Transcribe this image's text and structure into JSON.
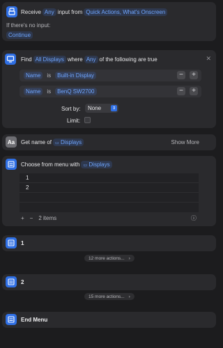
{
  "receive": {
    "label": "Receive",
    "any": "Any",
    "input_from": "input from",
    "sources": "Quick Actions, What's Onscreen",
    "no_input_label": "If there's no input:",
    "continue": "Continue"
  },
  "find": {
    "label": "Find",
    "target": "All Displays",
    "where": "where",
    "any": "Any",
    "suffix": "of the following are true",
    "conditions": [
      {
        "field": "Name",
        "op": "is",
        "value": "Built-in Display"
      },
      {
        "field": "Name",
        "op": "is",
        "value": "BenQ SW2700"
      }
    ],
    "sort_label": "Sort by:",
    "sort_value": "None",
    "limit_label": "Limit:"
  },
  "get_name": {
    "label": "Get name of",
    "target": "Displays",
    "show_more": "Show More",
    "icon_text": "Aa"
  },
  "choose_menu": {
    "label": "Choose from menu with",
    "target": "Displays",
    "items": [
      "1",
      "2"
    ],
    "count": "2 items",
    "add": "+",
    "remove": "−"
  },
  "blocks": [
    {
      "label": "1",
      "more": "12 more actions..."
    },
    {
      "label": "2",
      "more": "15 more actions..."
    }
  ],
  "end_menu": {
    "label": "End Menu"
  },
  "colors": {
    "accent": "#2f6fe4",
    "pill_text": "#6fa6ff",
    "card": "#2a2a2d",
    "background": "#1c1c1e"
  }
}
